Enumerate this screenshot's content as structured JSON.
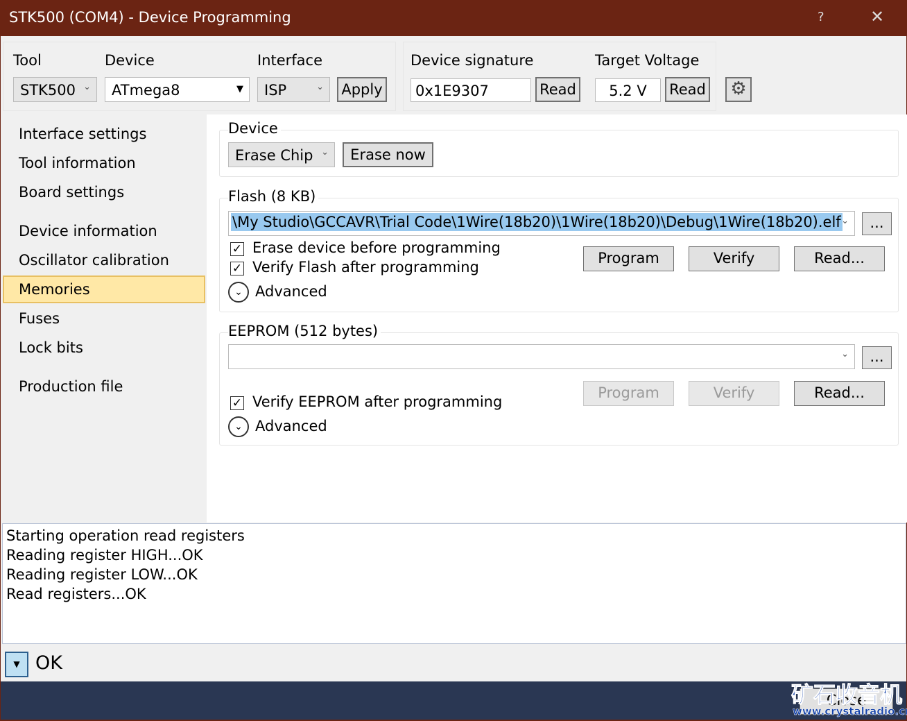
{
  "window": {
    "title": "STK500 (COM4) - Device Programming",
    "help": "?",
    "close": "✕"
  },
  "toolbar": {
    "tool_label": "Tool",
    "tool_value": "STK500",
    "device_label": "Device",
    "device_value": "ATmega8",
    "interface_label": "Interface",
    "interface_value": "ISP",
    "apply": "Apply",
    "signature_label": "Device signature",
    "signature_value": "0x1E9307",
    "read": "Read",
    "voltage_label": "Target Voltage",
    "voltage_value": "5.2 V",
    "read2": "Read",
    "settings_icon": "gear-icon"
  },
  "sidebar": {
    "items": [
      {
        "label": "Interface settings"
      },
      {
        "label": "Tool information"
      },
      {
        "label": "Board settings"
      },
      {
        "label": "Device information"
      },
      {
        "label": "Oscillator calibration"
      },
      {
        "label": "Memories"
      },
      {
        "label": "Fuses"
      },
      {
        "label": "Lock bits"
      },
      {
        "label": "Production file"
      }
    ]
  },
  "device": {
    "title": "Device",
    "erase_mode": "Erase Chip",
    "erase_now": "Erase now"
  },
  "flash": {
    "title": "Flash (8 KB)",
    "file": "\\My Studio\\GCCAVR\\Trial Code\\1Wire(18b20)\\1Wire(18b20)\\Debug\\1Wire(18b20).elf",
    "browse": "...",
    "erase_before": "Erase device before programming",
    "verify_after": "Verify Flash after programming",
    "advanced": "Advanced",
    "program": "Program",
    "verify": "Verify",
    "read": "Read..."
  },
  "eeprom": {
    "title": "EEPROM (512 bytes)",
    "file": "",
    "browse": "...",
    "verify_after": "Verify EEPROM after programming",
    "advanced": "Advanced",
    "program": "Program",
    "verify": "Verify",
    "read": "Read..."
  },
  "log": {
    "lines": [
      "Starting operation read registers",
      "Reading register HIGH...OK",
      "Reading register LOW...OK",
      "Read registers...OK"
    ]
  },
  "status": {
    "text": "OK"
  },
  "footer": {
    "close": "Close",
    "watermark_cn": "矿石收音机",
    "watermark_url": "www.crystalradio.cn"
  }
}
